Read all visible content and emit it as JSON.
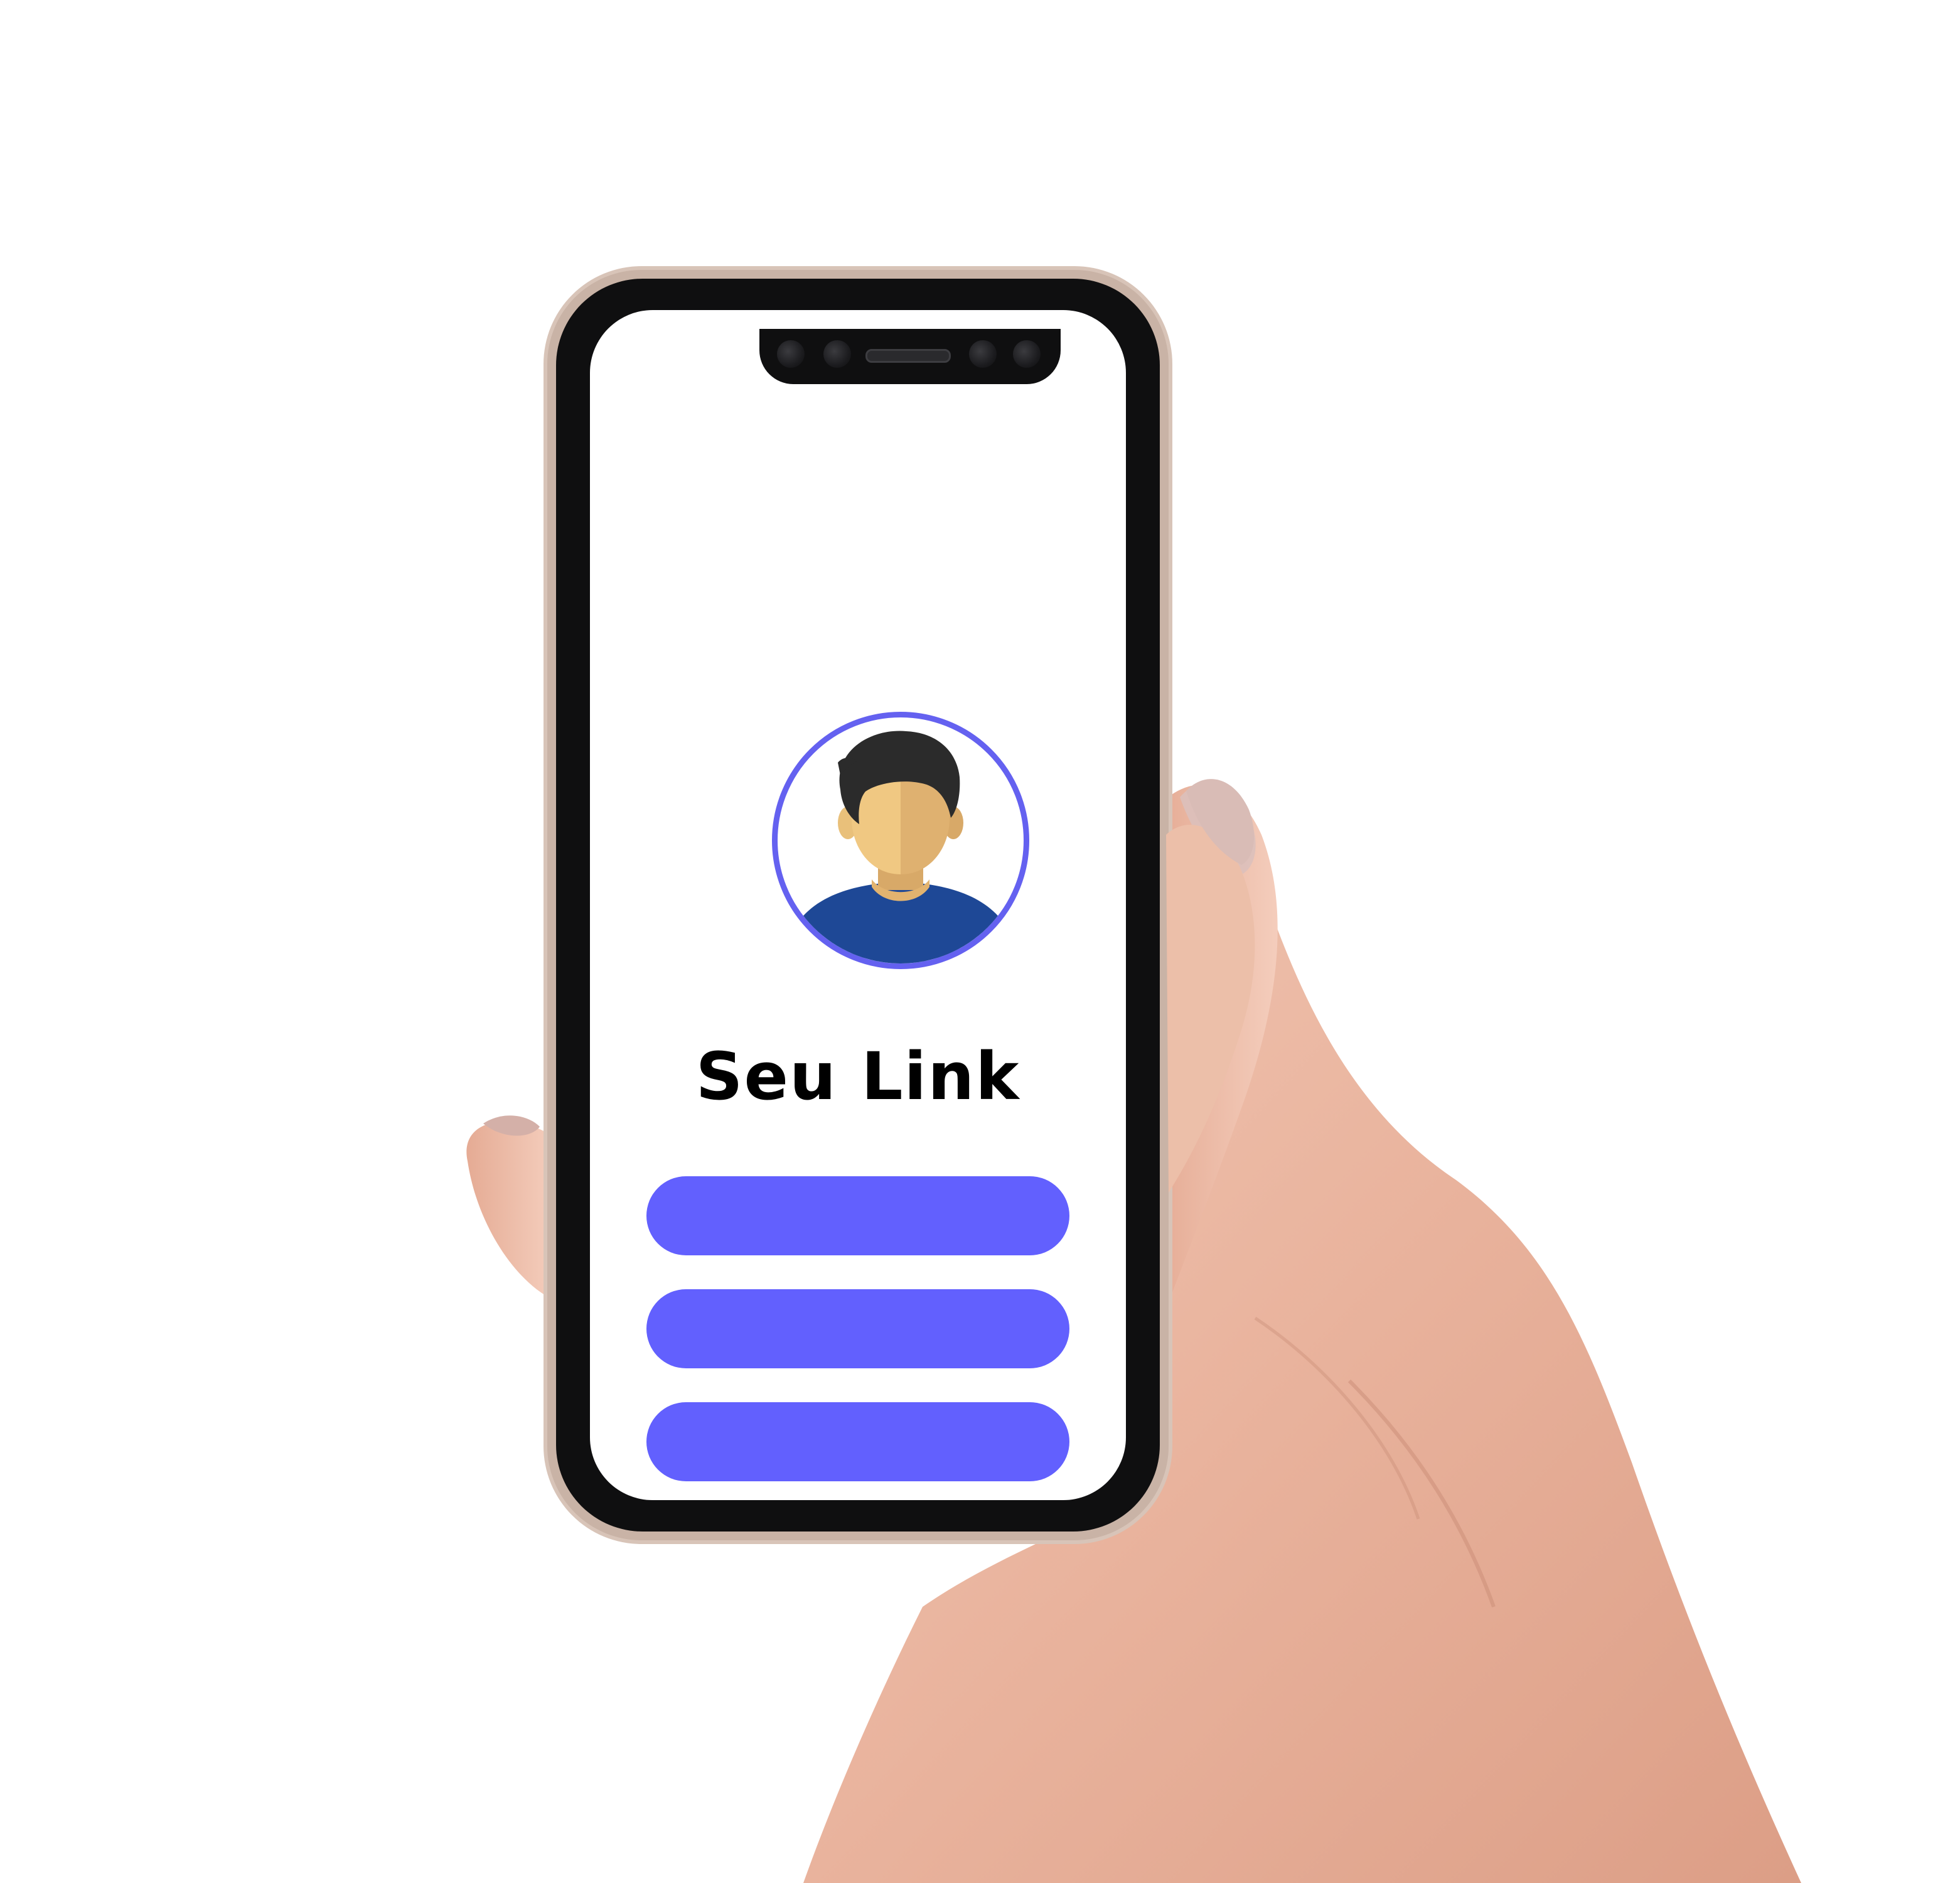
{
  "profile": {
    "name": "Seu Link",
    "avatar_icon": "user-avatar-icon",
    "accent_color": "#6461f0"
  },
  "links": [
    {
      "label": "",
      "color": "#6260fe"
    },
    {
      "label": "",
      "color": "#6260fe"
    },
    {
      "label": "",
      "color": "#6260fe"
    },
    {
      "label": "",
      "color": "#6260fe"
    }
  ],
  "device": {
    "frame_color": "#0f0f10",
    "screen_color": "#ffffff"
  }
}
